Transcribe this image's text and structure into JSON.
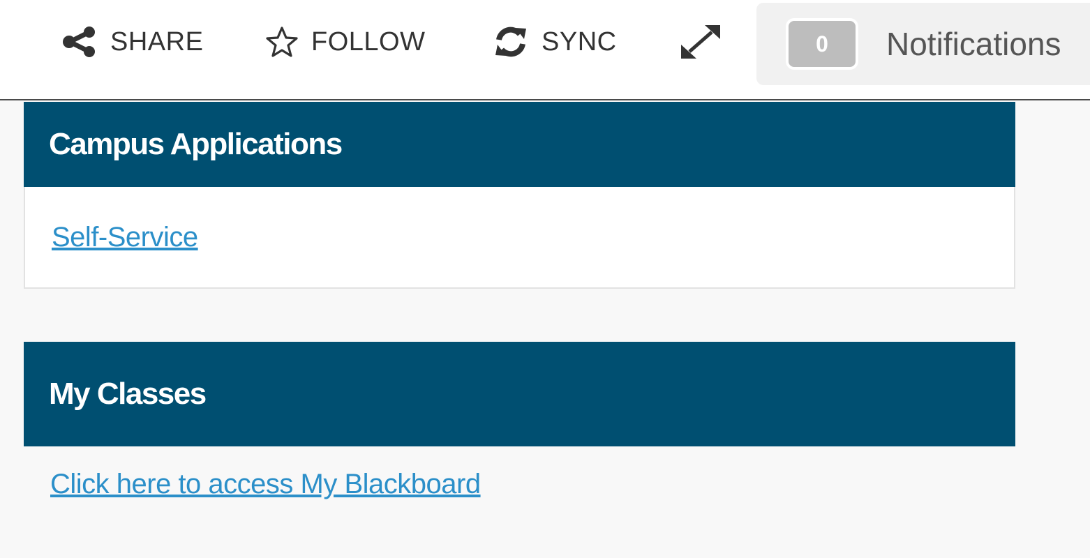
{
  "toolbar": {
    "share_label": "SHARE",
    "follow_label": "FOLLOW",
    "sync_label": "SYNC",
    "notifications": {
      "count": "0",
      "label": "Notifications"
    }
  },
  "panels": {
    "campus_applications": {
      "title": "Campus Applications",
      "links": [
        "Self-Service"
      ]
    },
    "my_classes": {
      "title": "My Classes",
      "link": "Click here to access My Blackboard"
    }
  },
  "colors": {
    "header_bg": "#004f71",
    "link": "#2b8fc9",
    "page_bg": "#f8f8f8"
  },
  "icons": [
    "share-icon",
    "star-outline-icon",
    "sync-icon",
    "expand-icon"
  ]
}
